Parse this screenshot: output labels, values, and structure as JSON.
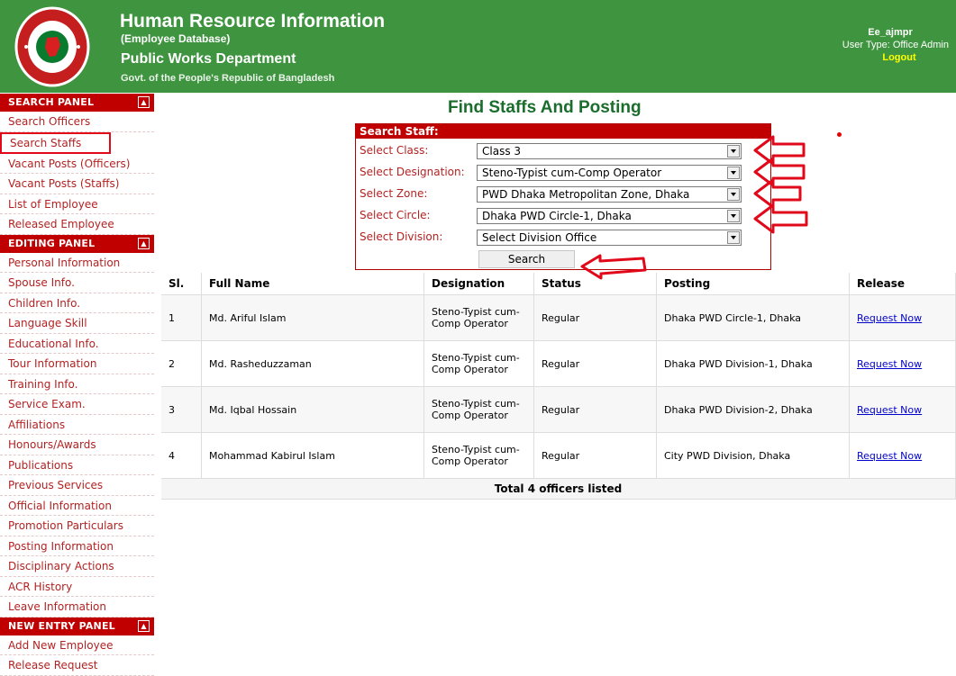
{
  "header": {
    "title": "Human Resource Information",
    "subtitle": "(Employee Database)",
    "department": "Public Works Department",
    "government": "Govt. of the People's Republic of Bangladesh",
    "username": "Ee_ajmpr",
    "user_type": "User Type: Office Admin",
    "logout": "Logout"
  },
  "sidebar": {
    "search_panel": {
      "title": "SEARCH PANEL",
      "items": [
        "Search Officers",
        "Search Staffs",
        "Vacant Posts (Officers)",
        "Vacant Posts (Staffs)",
        "List of Employee",
        "Released Employee"
      ]
    },
    "editing_panel": {
      "title": "EDITING PANEL",
      "items": [
        "Personal Information",
        "Spouse Info.",
        "Children Info.",
        "Language Skill",
        "Educational Info.",
        "Tour Information",
        "Training Info.",
        "Service Exam.",
        "Affiliations",
        "Honours/Awards",
        "Publications",
        "Previous Services",
        "Official Information",
        "Promotion Particulars",
        "Posting Information",
        "Disciplinary Actions",
        "ACR History",
        "Leave Information"
      ]
    },
    "new_entry_panel": {
      "title": "NEW ENTRY PANEL",
      "items": [
        "Add New Employee",
        "Release Request"
      ]
    }
  },
  "main": {
    "page_title": "Find Staffs And Posting",
    "search": {
      "header": "Search Staff:",
      "class_label": "Select Class:",
      "class_value": "Class 3",
      "designation_label": "Select Designation:",
      "designation_value": "Steno-Typist cum-Comp Operator",
      "zone_label": "Select Zone:",
      "zone_value": "PWD Dhaka Metropolitan Zone, Dhaka",
      "circle_label": "Select Circle:",
      "circle_value": "Dhaka PWD Circle-1, Dhaka",
      "division_label": "Select Division:",
      "division_value": "Select Division Office",
      "button": "Search"
    },
    "table": {
      "headers": [
        "Sl.",
        "Full Name",
        "Designation",
        "Status",
        "Posting",
        "Release"
      ],
      "rows": [
        {
          "sl": "1",
          "name": "Md. Ariful Islam",
          "designation": "Steno-Typist cum-Comp Operator",
          "status": "Regular",
          "posting": "Dhaka PWD Circle-1, Dhaka",
          "release": "Request Now"
        },
        {
          "sl": "2",
          "name": "Md. Rasheduzzaman",
          "designation": "Steno-Typist cum-Comp Operator",
          "status": "Regular",
          "posting": "Dhaka PWD Division-1, Dhaka",
          "release": "Request Now"
        },
        {
          "sl": "3",
          "name": "Md. Iqbal Hossain",
          "designation": "Steno-Typist cum-Comp Operator",
          "status": "Regular",
          "posting": "Dhaka PWD Division-2, Dhaka",
          "release": "Request Now"
        },
        {
          "sl": "4",
          "name": "Mohammad Kabirul Islam",
          "designation": "Steno-Typist cum-Comp Operator",
          "status": "Regular",
          "posting": "City PWD Division, Dhaka",
          "release": "Request Now"
        }
      ],
      "total": "Total 4 officers listed"
    }
  },
  "colors": {
    "header_bg": "#3f9440",
    "panel_red": "#c00000",
    "title_green": "#1a6d2c",
    "link_blue": "#0000cc",
    "annotation_red": "#e1081a"
  },
  "icons": {
    "logo": "bangladesh-government-seal",
    "collapse": "collapse-up-icon",
    "dropdown": "chevron-down-icon",
    "annotation": "red-arrow-icon"
  }
}
